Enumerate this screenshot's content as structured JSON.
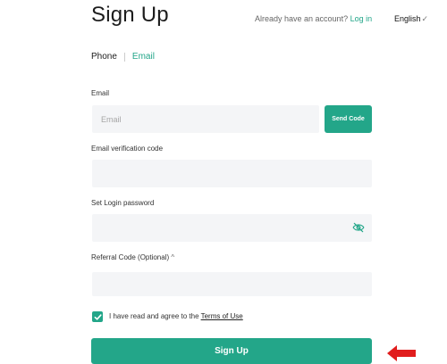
{
  "header": {
    "title": "Sign Up",
    "account_prompt": "Already have an account?",
    "login_link": "Log in",
    "language": "English",
    "language_chevron": "✓"
  },
  "tabs": {
    "phone": "Phone",
    "email": "Email",
    "active": "Email"
  },
  "form": {
    "email_label": "Email",
    "email_placeholder": "Email",
    "send_code": "Send Code",
    "verification_label": "Email verification code",
    "password_label": "Set Login password",
    "referral_label": "Referral Code (Optional)",
    "referral_caret": "^",
    "agree_text": "I have read and agree to the ",
    "terms_link": "Terms of Use",
    "agree_checked": true,
    "submit": "Sign Up"
  },
  "icons": {
    "password_visibility": "eye-slash-icon",
    "annotation_arrow": "red-arrow-left-icon"
  },
  "colors": {
    "accent": "#23a689",
    "field_bg": "#f4f5f7",
    "annotation": "#e11d1d"
  }
}
